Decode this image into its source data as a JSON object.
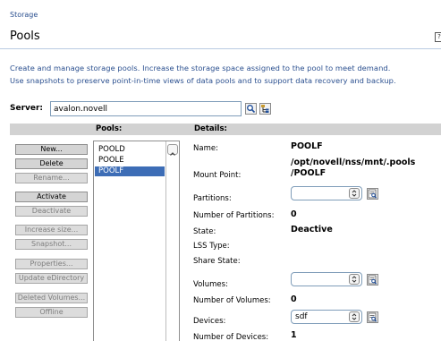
{
  "breadcrumb": "Storage",
  "page_title": "Pools",
  "description": {
    "line1": "Create and manage storage pools. Increase the storage space assigned to the pool to meet demand.",
    "line2": "Use snapshots to preserve point-in-time views of data pools and to support data recovery and backup."
  },
  "server": {
    "label": "Server:",
    "value": "avalon.novell"
  },
  "columns": {
    "pools": "Pools:",
    "details": "Details:"
  },
  "actions": [
    {
      "label": "New...",
      "enabled": true
    },
    {
      "label": "Delete",
      "enabled": true
    },
    {
      "label": "Rename...",
      "enabled": false
    },
    {
      "label": "Activate",
      "enabled": true
    },
    {
      "label": "Deactivate",
      "enabled": false
    },
    {
      "label": "Increase size...",
      "enabled": false
    },
    {
      "label": "Snapshot...",
      "enabled": false
    },
    {
      "label": "Properties...",
      "enabled": false
    },
    {
      "label": "Update eDirectory",
      "enabled": false
    },
    {
      "label": "Deleted Volumes...",
      "enabled": false
    },
    {
      "label": "Offline",
      "enabled": false
    }
  ],
  "pools": [
    {
      "name": "POOLD",
      "selected": false
    },
    {
      "name": "POOLE",
      "selected": false
    },
    {
      "name": "POOLF",
      "selected": true
    }
  ],
  "details": {
    "name_label": "Name:",
    "name_value": "POOLF",
    "mount_label": "Mount Point:",
    "mount_value_1": "/opt/novell/nss/mnt/.pools",
    "mount_value_2": "/POOLF",
    "partitions_label": "Partitions:",
    "partitions_select": "",
    "num_partitions_label": "Number of Partitions:",
    "num_partitions_value": "0",
    "state_label": "State:",
    "state_value": "Deactive",
    "lss_label": "LSS Type:",
    "share_label": "Share State:",
    "volumes_label": "Volumes:",
    "volumes_select": "",
    "num_volumes_label": "Number of Volumes:",
    "num_volumes_value": "0",
    "devices_label": "Devices:",
    "devices_select": "sdf",
    "num_devices_label": "Number of Devices:",
    "num_devices_value": "1"
  },
  "colors": {
    "accent_text": "#2a4f8f",
    "selection": "#3d6db6",
    "header_band": "#d2d2d2"
  }
}
